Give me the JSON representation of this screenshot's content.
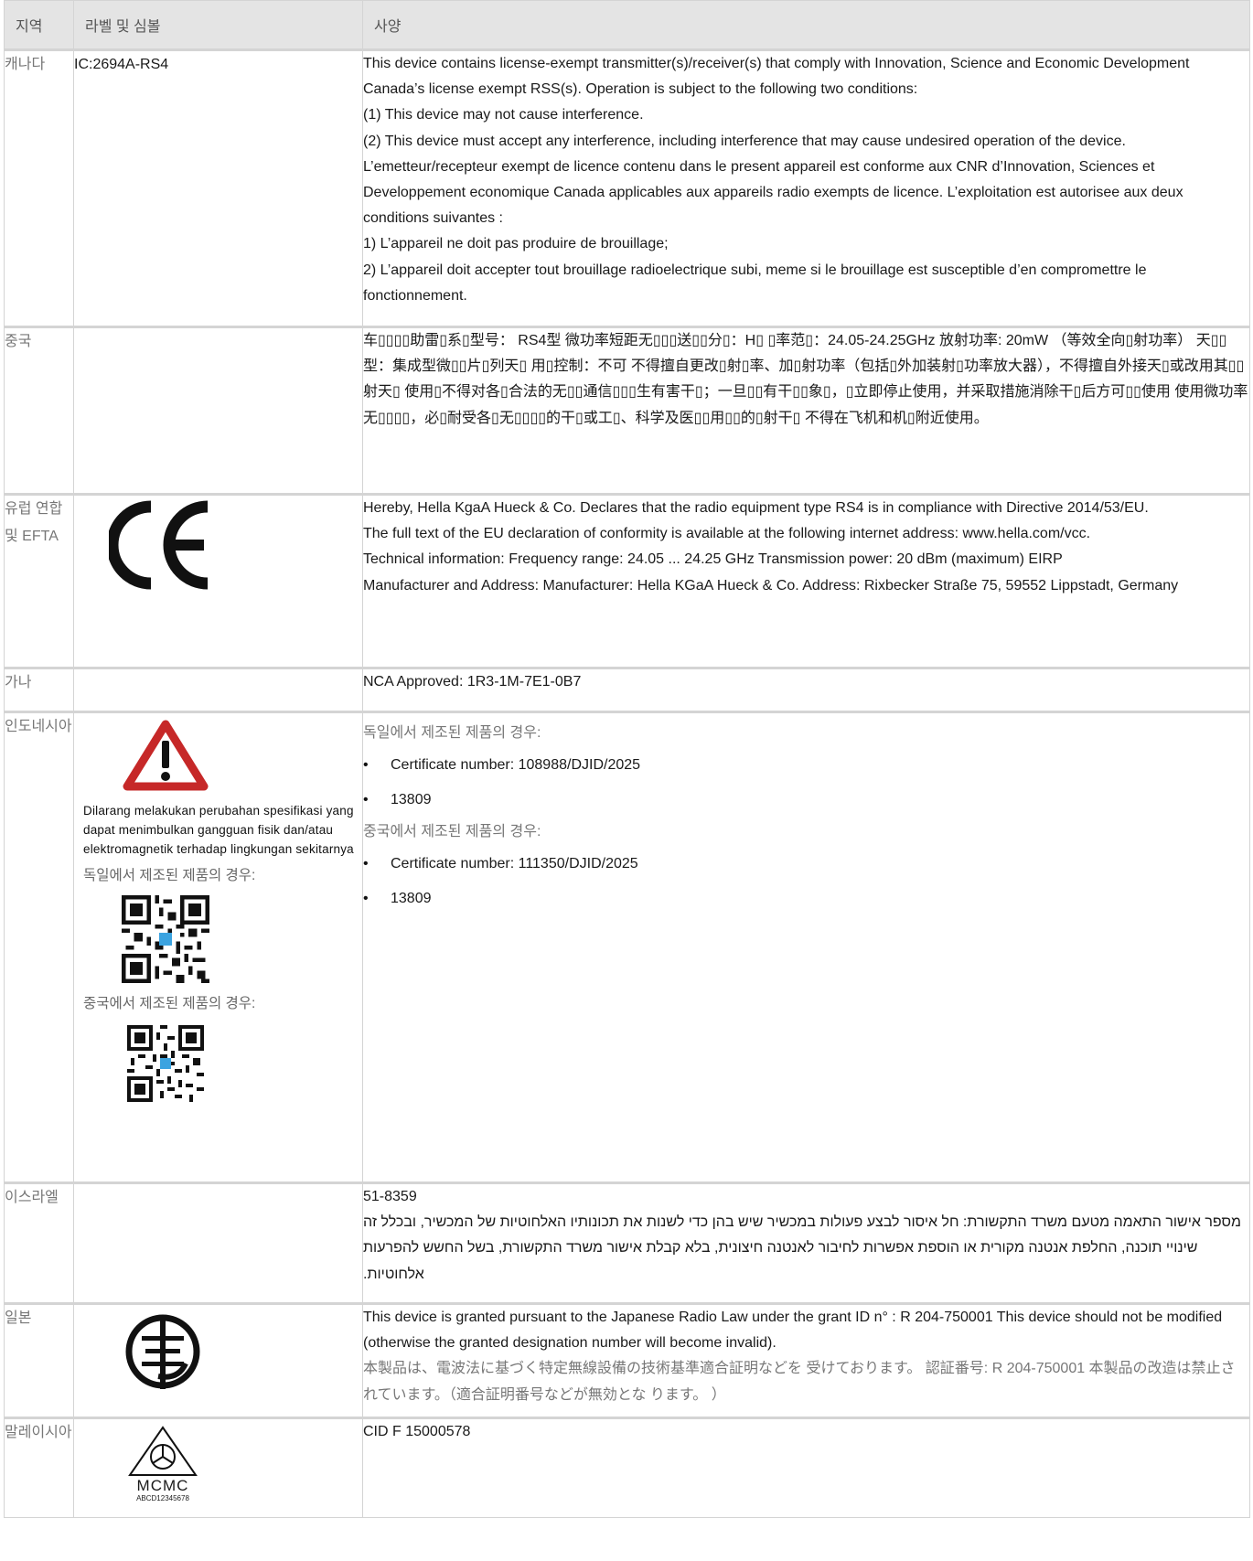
{
  "header": {
    "region": "지역",
    "label": "라벨 및 심볼",
    "spec": "사양"
  },
  "rows": {
    "canada": {
      "region": "캐나다",
      "label": "IC:2694A-RS4",
      "spec": [
        "This device contains license-exempt transmitter(s)/receiver(s) that comply with Innovation, Science and Economic Development Canada’s license exempt RSS(s). Operation is subject to the following two conditions:",
        "(1) This device may not cause interference.",
        "(2) This device must accept any interference, including interference that may cause undesired operation of the device.",
        "L’emetteur/recepteur exempt de licence contenu dans le present appareil est conforme aux CNR d’Innovation, Sciences et Developpement economique Canada applicables aux appareils radio exempts de licence. L’exploitation est autorisee aux deux conditions suivantes :",
        "1) L’appareil ne doit pas produire de brouillage;",
        "2) L’appareil doit accepter tout brouillage radioelectrique subi, meme si le brouillage est susceptible d’en compromettre le fonctionnement."
      ]
    },
    "china": {
      "region": "중국",
      "spec": "车▯▯▯▯助雷▯系▯型号： RS4型 微功率短距无▯▯▯送▯▯分▯：H▯ ▯率范▯：24.05-24.25GHz 放射功率: 20mW （等效全向▯射功率） 天▯▯型：集成型微▯▯片▯列天▯ 用▯控制：不可 不得擅自更改▯射▯率、加▯射功率（包括▯外加装射▯功率放大器），不得擅自外接天▯或改用其▯▯射天▯ 使用▯不得对各▯合法的无▯▯通信▯▯▯生有害干▯；一旦▯▯有干▯▯象▯，▯立即停止使用，并采取措施消除干▯后方可▯▯使用 使用微功率无▯▯▯▯，必▯耐受各▯无▯▯▯▯的干▯或工▯、科学及医▯▯用▯▯的▯射干▯ 不得在飞机和机▯附近使用。"
    },
    "eu": {
      "region": "유럽 연합 및 EFTA",
      "mark_text": "CE",
      "spec": [
        "Hereby, Hella KgaA Hueck & Co. Declares that the radio equipment type RS4 is in compliance with Directive 2014/53/EU.",
        "The full text of the EU declaration of conformity is available at the following internet address: www.hella.com/vcc.",
        "Technical information: Frequency range: 24.05 ... 24.25 GHz Transmission power: 20 dBm (maximum) EIRP",
        "Manufacturer and Address: Manufacturer: Hella KGaA Hueck & Co. Address: Rixbecker Straße 75, 59552 Lippstadt, Germany"
      ]
    },
    "ghana": {
      "region": "가나",
      "spec": "NCA Approved: 1R3-1M-7E1-0B7"
    },
    "indonesia": {
      "region": "인도네시아",
      "warning": "Dilarang melakukan perubahan spesifikasi yang dapat menimbulkan gangguan fisik dan/atau elektromagnetik terhadap lingkungan sekitarnya",
      "made_in_germany": "독일에서 제조된 제품의 경우:",
      "made_in_china": "중국에서 제조된 제품의 경우:",
      "spec_germany_heading": "독일에서 제조된 제품의 경우:",
      "spec_germany_items": [
        "Certificate number: 108988/DJID/2025",
        "13809"
      ],
      "spec_china_heading": "중국에서 제조된 제품의 경우:",
      "spec_china_items": [
        "Certificate number: 111350/DJID/2025",
        "13809"
      ]
    },
    "israel": {
      "region": "이스라엘",
      "number": "51-8359",
      "text": "מספר אישור התאמה מטעם משרד התקשורת: חל איסור לבצע פעולות במכשיר שיש בהן כדי לשנות את תכונותיו האלחוטיות של המכשיר, ובכלל זה שינויי תוכנה, החלפת אנטנה מקורית או הוספת אפשרות לחיבור לאנטנה חיצונית, בלא קבלת אישור משרד התקשורת, בשל החשש להפרעות אלחוטיות."
    },
    "japan": {
      "region": "일본",
      "spec_en": "This device is granted pursuant to the Japanese Radio Law under the grant ID n° : R 204-750001 This device should not be modified (otherwise the granted designation number will become invalid).",
      "spec_jp": "本製品は、電波法に基づく特定無線設備の技術基準適合証明などを 受けております。 認証番号: R 204-750001 本製品の改造は禁止されています。（適合証明番号などが無効とな ります。 ）"
    },
    "malaysia": {
      "region": "말레이시아",
      "mark_brand": "MCMC",
      "mark_code": "ABCD12345678",
      "spec": "CID F 15000578"
    }
  }
}
